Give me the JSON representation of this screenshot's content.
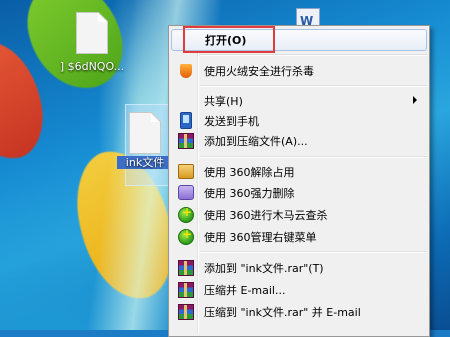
{
  "desktop": {
    "icons": [
      {
        "label": "] $6dNQO..."
      },
      {
        "label": "ink文件"
      },
      {
        "label": ""
      }
    ]
  },
  "context_menu": {
    "items": [
      {
        "label": "打开(O)",
        "icon": "",
        "bold": true,
        "highlighted": true
      },
      {
        "label": "使用火绒安全进行杀毒",
        "icon": "huorong-shield-icon"
      },
      {
        "label": "共享(H)",
        "icon": "",
        "submenu": true
      },
      {
        "label": "发送到手机",
        "icon": "phone-icon"
      },
      {
        "label": "添加到压缩文件(A)...",
        "icon": "winrar-icon"
      },
      {
        "label": "使用 360解除占用",
        "icon": "360-unlock-icon"
      },
      {
        "label": "使用 360强力删除",
        "icon": "360-delete-icon"
      },
      {
        "label": "使用 360进行木马云查杀",
        "icon": "360-scan-icon"
      },
      {
        "label": "使用 360管理右键菜单",
        "icon": "360-menu-icon"
      },
      {
        "label": "添加到 \"ink文件.rar\"(T)",
        "icon": "winrar-icon"
      },
      {
        "label": "压缩并 E-mail...",
        "icon": "winrar-icon"
      },
      {
        "label": "压缩到 \"ink文件.rar\" 并 E-mail",
        "icon": "winrar-icon"
      }
    ]
  },
  "colors": {
    "highlight_border": "#e03c3c",
    "menu_background": "#f0f0f0",
    "hover_border": "#a9c3e6"
  }
}
